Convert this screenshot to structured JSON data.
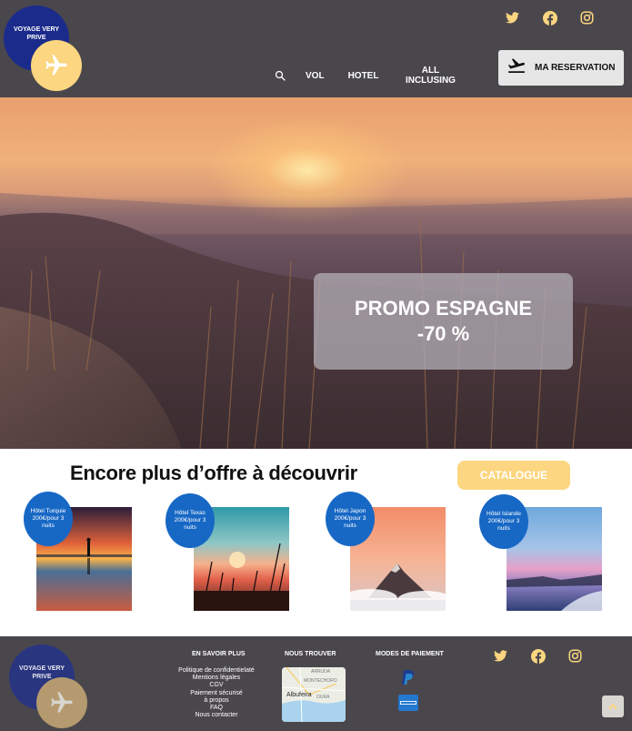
{
  "brand": {
    "name": "VOYAGE VERY PRIVE"
  },
  "header": {
    "social": [
      "twitter-icon",
      "facebook-icon",
      "instagram-icon"
    ],
    "nav": {
      "vol": "VOL",
      "hotel": "HOTEL",
      "all_inclusive": "ALL INCLUSING"
    },
    "reservation_label": "MA RESERVATION"
  },
  "hero": {
    "promo_line1": "PROMO ESPAGNE",
    "promo_line2": "-70 %"
  },
  "offers": {
    "title": "Encore plus d’offre à découvrir",
    "catalogue_label": "CATALOGUE",
    "cards": [
      {
        "badge": "Hôtel Turquie 200€/pour 3 nuits"
      },
      {
        "badge": "Hôtel Texas 200€/pour 3 nuits"
      },
      {
        "badge": "Hôtel Japon 200€/pour 3 nuits"
      },
      {
        "badge": "Hôtel Islande 200€/pour 3 nuits"
      }
    ]
  },
  "footer": {
    "col1_title": "EN SAVOIR PLUS",
    "col2_title": "NOUS TROUVER",
    "col3_title": "MODES DE PAIEMENT",
    "links": [
      "Politique de confidentielaté",
      "Mentions légales",
      "CGV",
      "Paiement sécurisé",
      "à propos",
      "FAQ",
      "Nous contacter"
    ],
    "map_labels": {
      "top": "ARRUDA",
      "mid": "MONTECHORO",
      "city": "Albufeira",
      "right": "OURA"
    },
    "payment": [
      "paypal-icon",
      "amex-icon"
    ]
  },
  "colors": {
    "header_bg": "#4a474c",
    "accent_yellow": "#fcd680",
    "accent_blue": "#1768c5",
    "logo_blue": "#1b2b8c"
  }
}
